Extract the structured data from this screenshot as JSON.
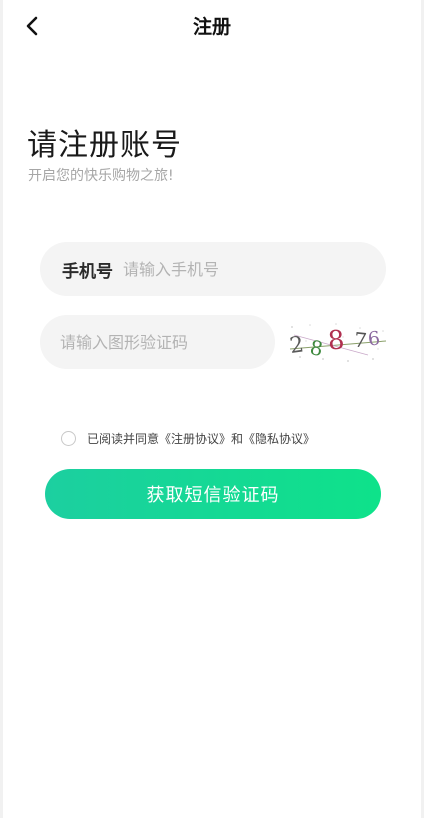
{
  "nav": {
    "title": "注册",
    "back_icon": "chevron-left-icon"
  },
  "heading": {
    "title": "请注册账号",
    "subtitle": "开启您的快乐购物之旅!"
  },
  "phone": {
    "label": "手机号",
    "placeholder": "请输入手机号",
    "value": ""
  },
  "captcha": {
    "placeholder": "请输入图形验证码",
    "value": "",
    "image_text": [
      "2",
      "8",
      "8",
      "7",
      "6"
    ]
  },
  "agreement": {
    "checked": false,
    "text": "已阅读并同意《注册协议》和《隐私协议》"
  },
  "submit": {
    "label": "获取短信验证码"
  },
  "colors": {
    "accent_start": "#1ccfa0",
    "accent_end": "#0ee28a",
    "field_bg": "#f4f4f4",
    "placeholder": "#b3b3b3"
  }
}
